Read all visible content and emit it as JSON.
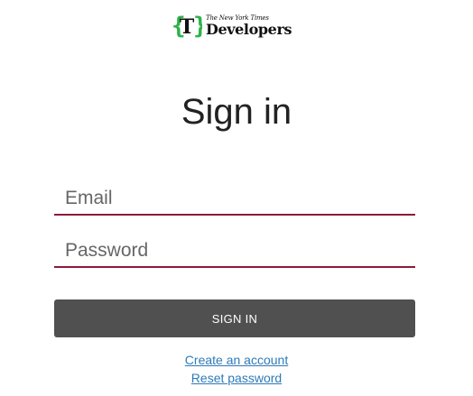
{
  "logo": {
    "tagline": "The New York Times",
    "wordmark": "Developers",
    "icon_name": "nyt-t-in-braces-logo",
    "brace_color": "#2db34a"
  },
  "title": "Sign in",
  "form": {
    "email_placeholder": "Email",
    "password_placeholder": "Password",
    "submit_label": "SIGN IN"
  },
  "links": {
    "create_account": "Create an account",
    "reset_password": "Reset password"
  },
  "colors": {
    "field_underline": "#8c1b3a",
    "button_background": "#505050",
    "link": "#2e7ab8"
  }
}
